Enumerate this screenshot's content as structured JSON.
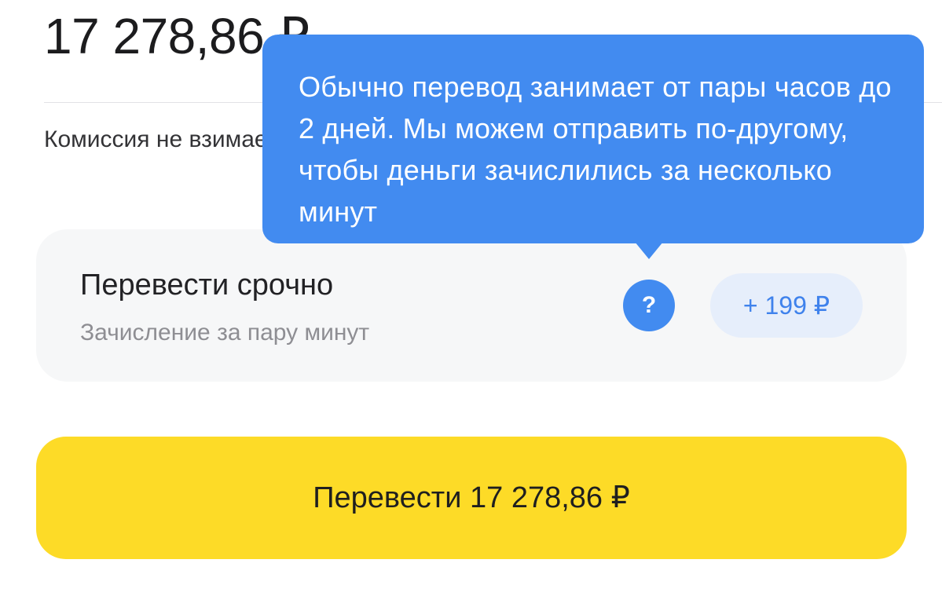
{
  "summary": {
    "amount": "17 278,86 ₽",
    "commission_text": "Комиссия не взимается"
  },
  "urgent_option": {
    "title": "Перевести срочно",
    "subtitle": "Зачисление за пару минут",
    "help_label": "?",
    "fee": "+ 199 ₽"
  },
  "tooltip": {
    "text": "Обычно перевод занимает от пары часов до 2 дней. Мы можем отправить по-другому, чтобы деньги зачислились за несколько минут"
  },
  "primary_action": {
    "label": "Перевести 17 278,86 ₽"
  },
  "colors": {
    "accent_blue": "#428bf0",
    "primary_yellow": "#fddb27",
    "card_background": "#f6f7f8"
  }
}
